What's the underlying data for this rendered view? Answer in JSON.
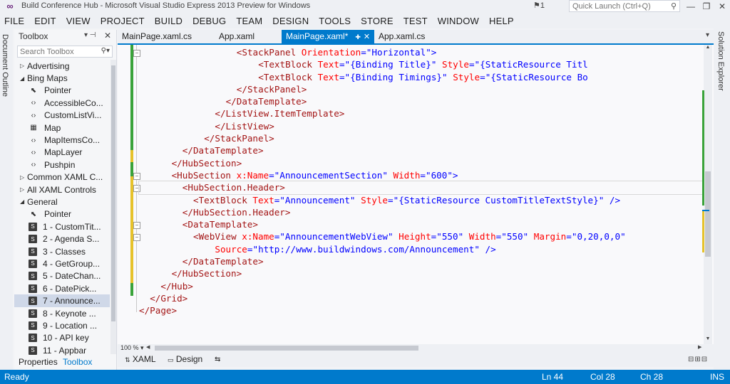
{
  "window": {
    "title": "Build Conference Hub - Microsoft Visual Studio Express 2013 Preview for Windows",
    "notifications": "1",
    "quick_launch_placeholder": "Quick Launch (Ctrl+Q)",
    "minimize": "—",
    "maximize": "❐",
    "close": "✕"
  },
  "menu": [
    "FILE",
    "EDIT",
    "VIEW",
    "PROJECT",
    "BUILD",
    "DEBUG",
    "TEAM",
    "DESIGN",
    "TOOLS",
    "STORE",
    "TEST",
    "WINDOW",
    "HELP"
  ],
  "left_panel_tab": "Document Outline",
  "right_panel_tab": "Solution Explorer",
  "toolbox": {
    "title": "Toolbox",
    "search_placeholder": "Search Toolbox",
    "items": [
      {
        "label": "Advertising",
        "kind": "category",
        "expanded": false
      },
      {
        "label": "Bing Maps",
        "kind": "category",
        "expanded": true
      },
      {
        "label": "Pointer",
        "kind": "item",
        "icon": "pointer-icon"
      },
      {
        "label": "AccessibleCo...",
        "kind": "item",
        "icon": "control-icon"
      },
      {
        "label": "CustomListVi...",
        "kind": "item",
        "icon": "control-icon"
      },
      {
        "label": "Map",
        "kind": "item",
        "icon": "map-icon"
      },
      {
        "label": "MapItemsCo...",
        "kind": "item",
        "icon": "control-icon"
      },
      {
        "label": "MapLayer",
        "kind": "item",
        "icon": "control-icon"
      },
      {
        "label": "Pushpin",
        "kind": "item",
        "icon": "control-icon"
      },
      {
        "label": "Common XAML C...",
        "kind": "category",
        "expanded": false
      },
      {
        "label": "All XAML Controls",
        "kind": "category",
        "expanded": false
      },
      {
        "label": "General",
        "kind": "category",
        "expanded": true
      },
      {
        "label": "Pointer",
        "kind": "item",
        "icon": "pointer-icon"
      },
      {
        "label": "1 - CustomTit...",
        "kind": "item",
        "icon": "snippet-icon"
      },
      {
        "label": "2 - Agenda S...",
        "kind": "item",
        "icon": "snippet-icon"
      },
      {
        "label": "3 - Classes",
        "kind": "item",
        "icon": "snippet-icon"
      },
      {
        "label": "4 - GetGroup...",
        "kind": "item",
        "icon": "snippet-icon"
      },
      {
        "label": "5 - DateChan...",
        "kind": "item",
        "icon": "snippet-icon"
      },
      {
        "label": "6 - DatePick...",
        "kind": "item",
        "icon": "snippet-icon"
      },
      {
        "label": "7 - Announce...",
        "kind": "item",
        "icon": "snippet-icon",
        "selected": true
      },
      {
        "label": "8 - Keynote ...",
        "kind": "item",
        "icon": "snippet-icon"
      },
      {
        "label": "9 - Location ...",
        "kind": "item",
        "icon": "snippet-icon"
      },
      {
        "label": "10 - API key",
        "kind": "item",
        "icon": "snippet-icon"
      },
      {
        "label": "11 - Appbar",
        "kind": "item",
        "icon": "snippet-icon"
      }
    ],
    "bottom_tabs": {
      "properties": "Properties",
      "toolbox": "Toolbox"
    }
  },
  "doc_tabs": [
    {
      "label": "MainPage.xaml.cs",
      "active": false
    },
    {
      "label": "App.xaml",
      "active": false
    },
    {
      "label": "MainPage.xaml*",
      "active": true
    },
    {
      "label": "App.xaml.cs",
      "active": false
    }
  ],
  "editor": {
    "lines": [
      [
        {
          "c": "t",
          "s": "<StackPanel "
        },
        {
          "c": "a",
          "s": "Orientation"
        },
        {
          "c": "p",
          "s": "=\""
        },
        {
          "c": "v",
          "s": "Horizontal"
        },
        {
          "c": "p",
          "s": "\">"
        }
      ],
      [
        {
          "c": "t",
          "s": "<TextBlock "
        },
        {
          "c": "a",
          "s": "Text"
        },
        {
          "c": "p",
          "s": "=\""
        },
        {
          "c": "v",
          "s": "{Binding Title}"
        },
        {
          "c": "p",
          "s": "\" "
        },
        {
          "c": "a",
          "s": "Style"
        },
        {
          "c": "p",
          "s": "=\""
        },
        {
          "c": "v",
          "s": "{StaticResource Titl"
        }
      ],
      [
        {
          "c": "t",
          "s": "<TextBlock "
        },
        {
          "c": "a",
          "s": "Text"
        },
        {
          "c": "p",
          "s": "=\""
        },
        {
          "c": "v",
          "s": "{Binding Timings}"
        },
        {
          "c": "p",
          "s": "\" "
        },
        {
          "c": "a",
          "s": "Style"
        },
        {
          "c": "p",
          "s": "=\""
        },
        {
          "c": "v",
          "s": "{StaticResource Bo"
        }
      ],
      [
        {
          "c": "t",
          "s": "</StackPanel>"
        }
      ],
      [
        {
          "c": "t",
          "s": "</DataTemplate>"
        }
      ],
      [
        {
          "c": "t",
          "s": "</ListView.ItemTemplate>"
        }
      ],
      [
        {
          "c": "t",
          "s": "</ListView>"
        }
      ],
      [
        {
          "c": "t",
          "s": "</StackPanel>"
        }
      ],
      [
        {
          "c": "t",
          "s": "</DataTemplate>"
        }
      ],
      [
        {
          "c": "t",
          "s": "</HubSection>"
        }
      ],
      [
        {
          "c": "t",
          "s": "<HubSection "
        },
        {
          "c": "a",
          "s": "x:Name"
        },
        {
          "c": "p",
          "s": "=\""
        },
        {
          "c": "v",
          "s": "AnnouncementSection"
        },
        {
          "c": "p",
          "s": "\" "
        },
        {
          "c": "a",
          "s": "Width"
        },
        {
          "c": "p",
          "s": "=\""
        },
        {
          "c": "v",
          "s": "600"
        },
        {
          "c": "p",
          "s": "\">"
        }
      ],
      [
        {
          "c": "t",
          "s": "<HubSection.Header>"
        }
      ],
      [
        {
          "c": "t",
          "s": "<TextBlock "
        },
        {
          "c": "a",
          "s": "Text"
        },
        {
          "c": "p",
          "s": "=\""
        },
        {
          "c": "v",
          "s": "Announcement"
        },
        {
          "c": "p",
          "s": "\" "
        },
        {
          "c": "a",
          "s": "Style"
        },
        {
          "c": "p",
          "s": "=\""
        },
        {
          "c": "v",
          "s": "{StaticResource CustomTitleTextStyle}"
        },
        {
          "c": "p",
          "s": "\" />"
        }
      ],
      [
        {
          "c": "t",
          "s": "</HubSection.Header>"
        }
      ],
      [
        {
          "c": "t",
          "s": "<DataTemplate>"
        }
      ],
      [
        {
          "c": "t",
          "s": "<WebView "
        },
        {
          "c": "a",
          "s": "x:Name"
        },
        {
          "c": "p",
          "s": "=\""
        },
        {
          "c": "v",
          "s": "AnnouncementWebView"
        },
        {
          "c": "p",
          "s": "\" "
        },
        {
          "c": "a",
          "s": "Height"
        },
        {
          "c": "p",
          "s": "=\""
        },
        {
          "c": "v",
          "s": "550"
        },
        {
          "c": "p",
          "s": "\" "
        },
        {
          "c": "a",
          "s": "Width"
        },
        {
          "c": "p",
          "s": "=\""
        },
        {
          "c": "v",
          "s": "550"
        },
        {
          "c": "p",
          "s": "\" "
        },
        {
          "c": "a",
          "s": "Margin"
        },
        {
          "c": "p",
          "s": "=\""
        },
        {
          "c": "v",
          "s": "0,20,0,0"
        },
        {
          "c": "p",
          "s": "\""
        }
      ],
      [
        {
          "c": "a",
          "s": "Source"
        },
        {
          "c": "p",
          "s": "=\""
        },
        {
          "c": "v",
          "s": "http://www.buildwindows.com/Announcement"
        },
        {
          "c": "p",
          "s": "\" />"
        }
      ],
      [
        {
          "c": "t",
          "s": "</DataTemplate>"
        }
      ],
      [
        {
          "c": "t",
          "s": "</HubSection>"
        }
      ],
      [
        {
          "c": "t",
          "s": "</Hub>"
        }
      ],
      [
        {
          "c": "t",
          "s": "</Grid>"
        }
      ],
      [
        {
          "c": "t",
          "s": "</Page>"
        }
      ]
    ],
    "current_line_index": 11,
    "zoom": "100 %"
  },
  "view_tabs": {
    "xaml": "XAML",
    "design": "Design"
  },
  "status": {
    "ready": "Ready",
    "ln": "Ln 44",
    "col": "Col 28",
    "ch": "Ch 28",
    "mode": "INS"
  },
  "colors": {
    "accent": "#007acc",
    "xml_tag": "#a31515",
    "xml_attribute": "#ff0000",
    "xml_value": "#0000ff",
    "change_saved": "#3aa33a",
    "change_unsaved": "#e6c22a"
  }
}
